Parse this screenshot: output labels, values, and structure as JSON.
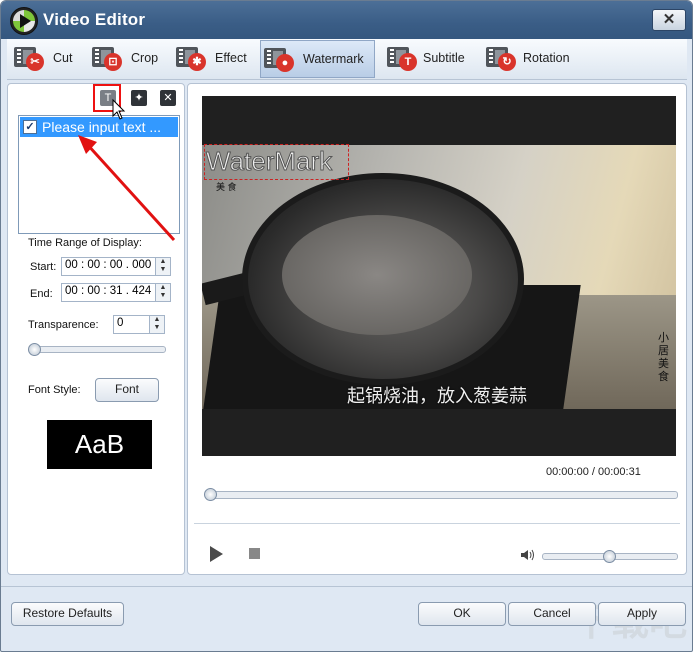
{
  "window": {
    "title": "Video Editor",
    "close_icon": "close-icon"
  },
  "tabs": [
    {
      "label": "Cut",
      "icon": "scissors-icon",
      "color": "#d9342b"
    },
    {
      "label": "Crop",
      "icon": "crop-icon",
      "color": "#d9342b"
    },
    {
      "label": "Effect",
      "icon": "effect-icon",
      "color": "#d9342b"
    },
    {
      "label": "Watermark",
      "icon": "watermark-icon",
      "color": "#d9342b",
      "active": true
    },
    {
      "label": "Subtitle",
      "icon": "subtitle-icon",
      "color": "#d9342b"
    },
    {
      "label": "Rotation",
      "icon": "rotation-icon",
      "color": "#d9342b"
    }
  ],
  "watermark_panel": {
    "toolbar": [
      "add-text-watermark-icon",
      "add-image-watermark-icon",
      "delete-watermark-icon"
    ],
    "items": [
      {
        "label": "Please input text ...",
        "checked": true
      }
    ],
    "time_range_label": "Time Range of Display:",
    "start_label": "Start:",
    "start_value": "00 : 00 : 00 . 000",
    "end_label": "End:",
    "end_value": "00 : 00 : 31 . 424",
    "transparence_label": "Transparence:",
    "transparence_value": "0",
    "transparence_level": 0,
    "font_style_label": "Font Style:",
    "font_button": "Font",
    "font_preview": "AaB"
  },
  "preview": {
    "watermark_text": "WaterMark",
    "overlay_sub": "美 食",
    "subtitle_text": "起锅烧油，放入葱姜蒜",
    "brand_text": "小居美食",
    "current_time": "00:00:00",
    "separator": "/",
    "total_time": "00:00:31",
    "seek_position": 0,
    "volume_level": 0.5
  },
  "footer": {
    "restore_defaults": "Restore Defaults",
    "ok": "OK",
    "cancel": "Cancel",
    "apply": "Apply",
    "bg_watermark": "下载吧"
  },
  "colors": {
    "title_bar": "#3a5d86",
    "selection": "#3399ff",
    "annotation": "#e11111"
  }
}
